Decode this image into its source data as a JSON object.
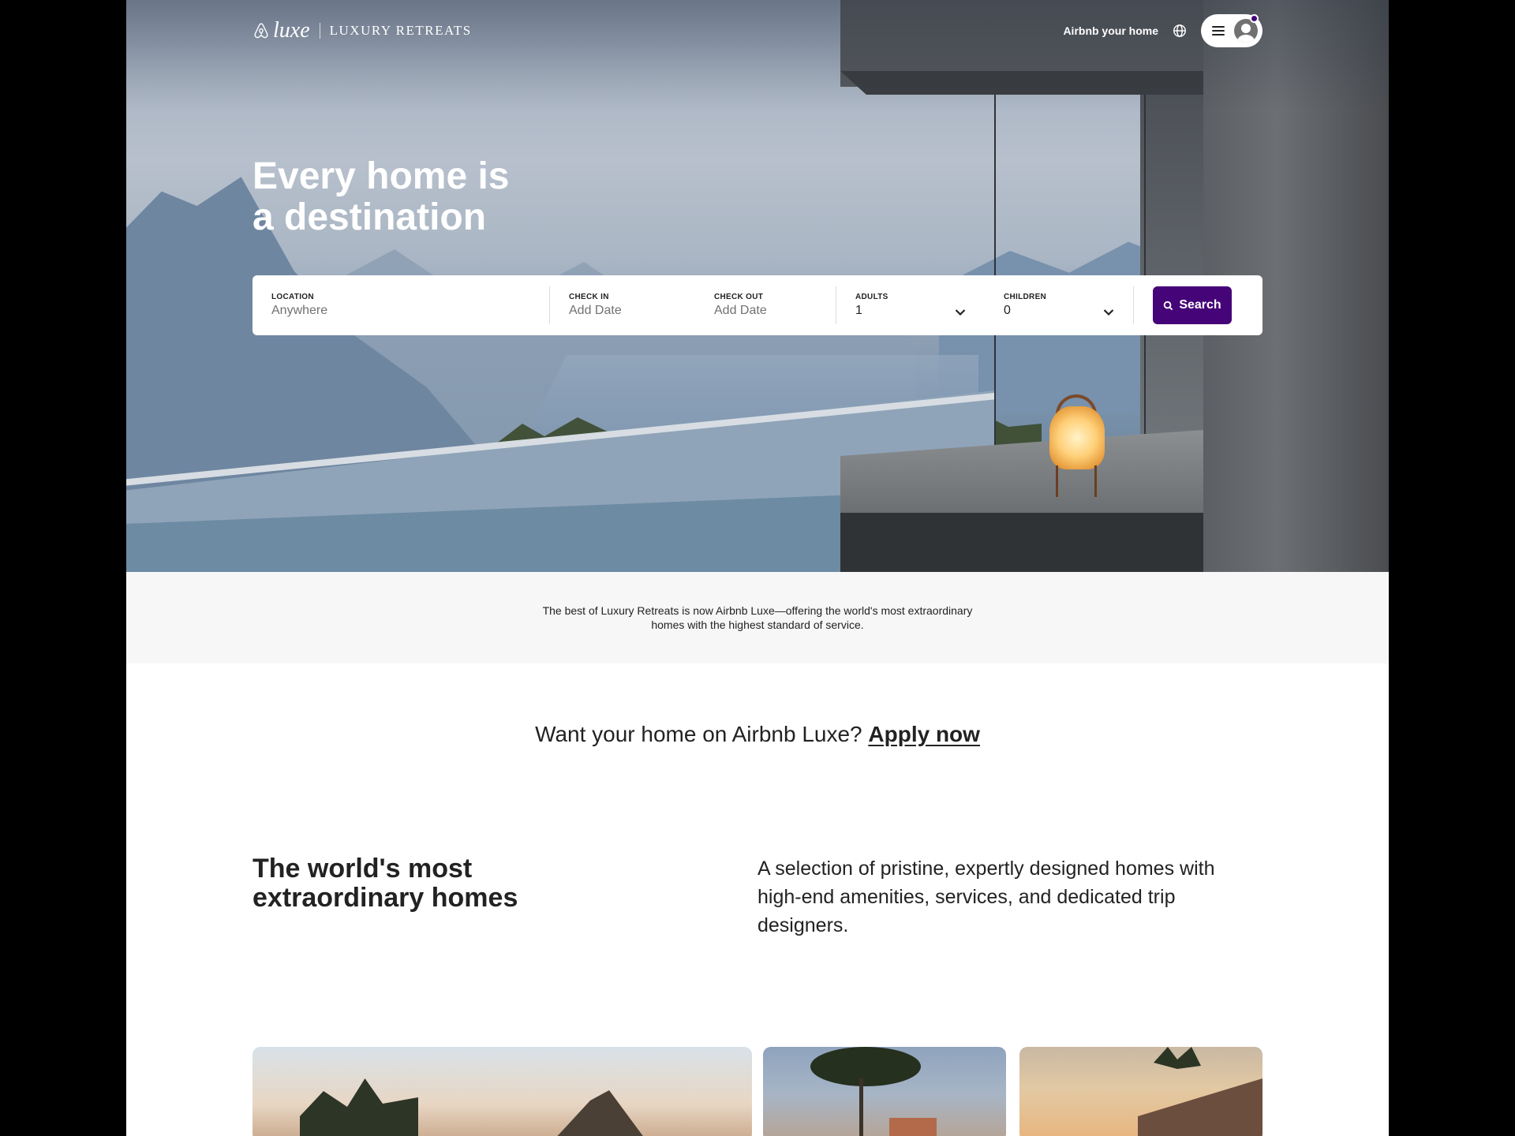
{
  "nav": {
    "logo_luxe": "luxe",
    "logo_retreats": "LUXURY RETREATS",
    "host_link": "Airbnb your home"
  },
  "hero": {
    "headline_line1": "Every home is",
    "headline_line2": "a destination"
  },
  "search": {
    "location_label": "LOCATION",
    "location_placeholder": "Anywhere",
    "checkin_label": "CHECK IN",
    "checkin_placeholder": "Add Date",
    "checkout_label": "CHECK OUT",
    "checkout_placeholder": "Add Date",
    "adults_label": "ADULTS",
    "adults_value": "1",
    "children_label": "CHILDREN",
    "children_value": "0",
    "button_label": "Search"
  },
  "info": {
    "text": "The best of Luxury Retreats is now Airbnb Luxe—offering the world's most extraordinary homes with the highest standard of service."
  },
  "apply": {
    "prefix": "Want your home on Airbnb Luxe?",
    "link": "Apply now"
  },
  "section": {
    "title": "The world's most extraordinary homes",
    "description": "A selection of pristine, expertly designed homes with high-end amenities, services, and dedicated trip designers."
  },
  "colors": {
    "brand_purple": "#460479",
    "text_dark": "#222222",
    "strip_bg": "#f7f7f7"
  },
  "icons": [
    "airbnb-logo-icon",
    "globe-icon",
    "menu-icon",
    "avatar-icon",
    "chevron-down-icon",
    "search-icon"
  ]
}
